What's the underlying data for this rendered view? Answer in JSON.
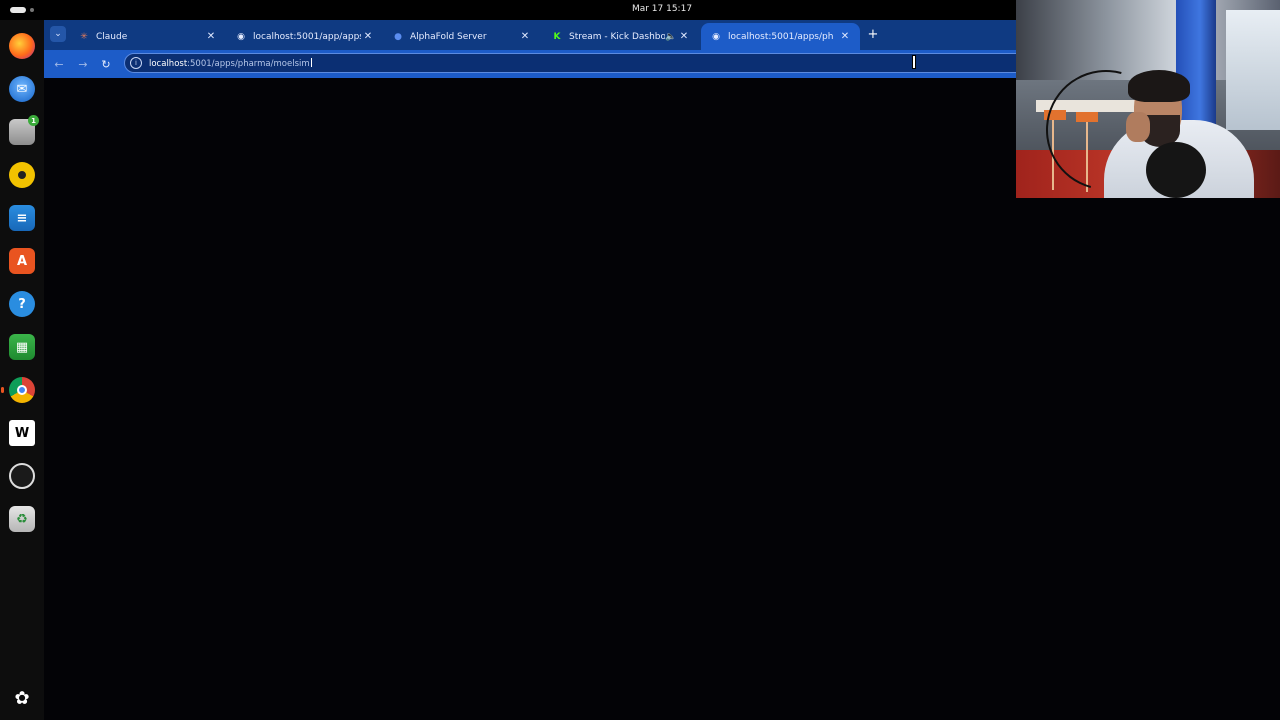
{
  "topbar": {
    "clock": "Mar 17  15:17"
  },
  "dock": {
    "items": [
      {
        "name": "firefox-icon"
      },
      {
        "name": "thunderbird-icon"
      },
      {
        "name": "files-icon",
        "badge": "1"
      },
      {
        "name": "rhythmbox-icon"
      },
      {
        "name": "writer-icon"
      },
      {
        "name": "app-center-icon"
      },
      {
        "name": "help-icon"
      },
      {
        "name": "calc-icon"
      },
      {
        "name": "chrome-icon"
      },
      {
        "name": "w-app-icon"
      },
      {
        "name": "obs-icon"
      },
      {
        "name": "trash-icon"
      },
      {
        "name": "show-apps-icon"
      }
    ]
  },
  "browser": {
    "tabs": [
      {
        "title": "Claude",
        "favicon": "claude-icon"
      },
      {
        "title": "localhost:5001/app/apps",
        "favicon": "globe-icon"
      },
      {
        "title": "AlphaFold Server",
        "favicon": "alphafold-icon"
      },
      {
        "title": "Stream - Kick Dashboa",
        "favicon": "kick-icon"
      },
      {
        "title": "localhost:5001/apps/ph",
        "favicon": "globe-icon"
      }
    ],
    "active_tab_index": 4,
    "address": {
      "host": "localhost",
      "rest": ":5001/apps/pharma/moelsim"
    }
  },
  "colors": {
    "tabstrip": "#0f3a82",
    "toolbar": "#1d5cc8",
    "page_background": "#030306",
    "accent": "#e95420"
  }
}
